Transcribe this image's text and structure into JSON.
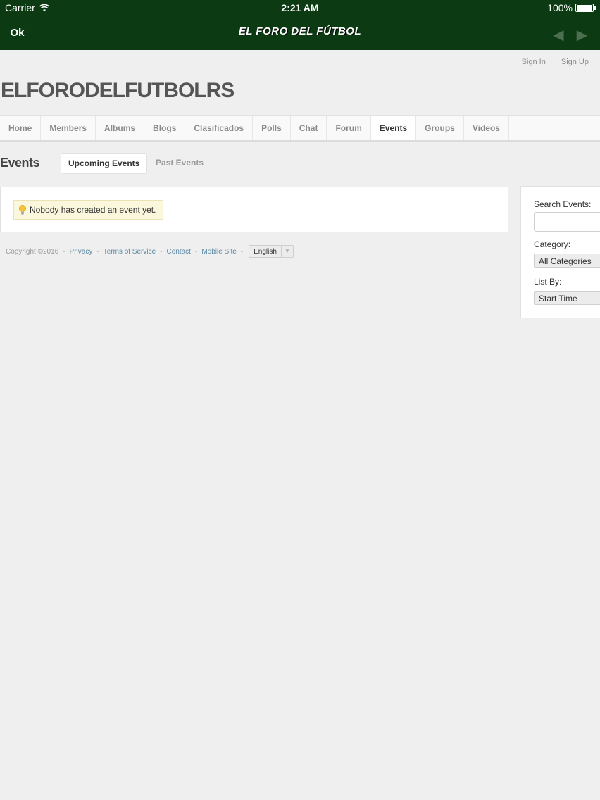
{
  "status_bar": {
    "carrier": "Carrier",
    "time": "2:21 AM",
    "battery": "100%"
  },
  "app_header": {
    "ok_label": "Ok",
    "brand": "EL FORO DEL FÚTBOL",
    "back_icon": "back-arrow-icon",
    "forward_icon": "forward-arrow-icon"
  },
  "auth": {
    "sign_in": "Sign In",
    "sign_up": "Sign Up"
  },
  "site": {
    "title": "ELFORODELFUTBOLRS"
  },
  "menu": {
    "items": [
      {
        "label": "Home"
      },
      {
        "label": "Members"
      },
      {
        "label": "Albums"
      },
      {
        "label": "Blogs"
      },
      {
        "label": "Clasificados"
      },
      {
        "label": "Polls"
      },
      {
        "label": "Chat"
      },
      {
        "label": "Forum"
      },
      {
        "label": "Events",
        "active": true
      },
      {
        "label": "Groups"
      },
      {
        "label": "Videos"
      }
    ]
  },
  "events": {
    "title": "Events",
    "tab_upcoming": "Upcoming Events",
    "tab_past": "Past Events",
    "notice": "Nobody has created an event yet."
  },
  "footer": {
    "copyright": "Copyright ©2016",
    "sep": "-",
    "privacy": "Privacy",
    "terms": "Terms of Service",
    "contact": "Contact",
    "mobile": "Mobile Site",
    "language": "English"
  },
  "sidebar": {
    "search_label": "Search Events:",
    "search_value": "",
    "category_label": "Category:",
    "category_value": "All Categories",
    "listby_label": "List By:",
    "listby_value": "Start Time"
  },
  "colors": {
    "header_green": "#0c3a12",
    "link_blue": "#5b8aa6"
  }
}
